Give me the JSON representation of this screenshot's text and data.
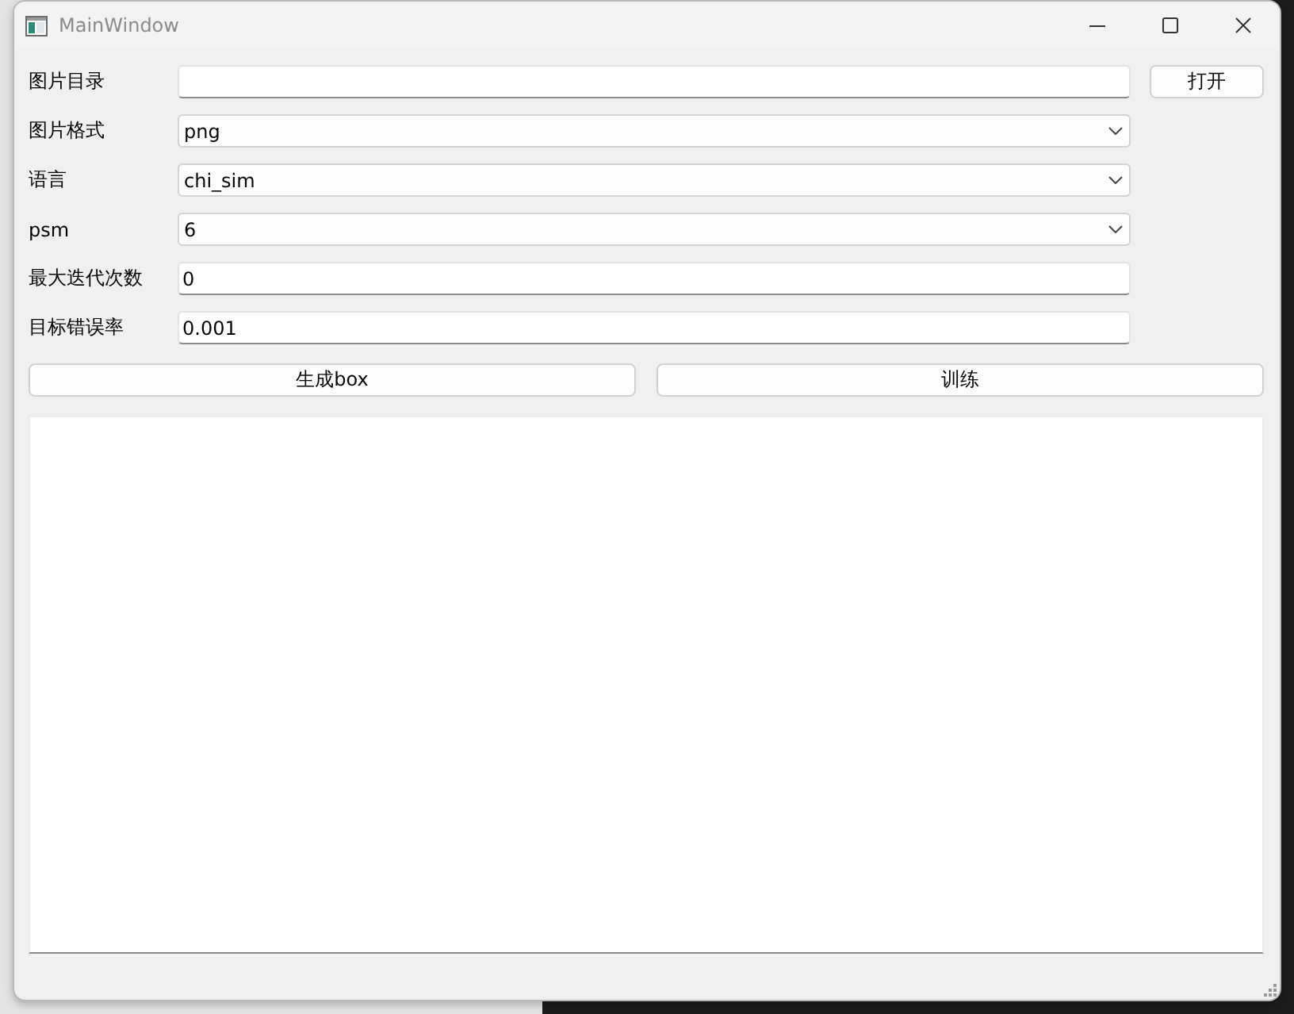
{
  "window": {
    "title": "MainWindow"
  },
  "form": {
    "rows": [
      {
        "kind": "input",
        "label": "图片目录",
        "button": "打开"
      },
      {
        "kind": "dropdown",
        "label": "图片格式",
        "value": "png"
      },
      {
        "kind": "dropdown",
        "label": "语言",
        "value": "chi_sim"
      },
      {
        "kind": "dropdown",
        "label": "psm",
        "value": "6"
      },
      {
        "kind": "input",
        "label": "最大迭代次数",
        "value": "0"
      },
      {
        "kind": "input",
        "label": "目标错误率",
        "value": "0.001"
      }
    ]
  },
  "buttons": [
    "生成box",
    "训练"
  ]
}
